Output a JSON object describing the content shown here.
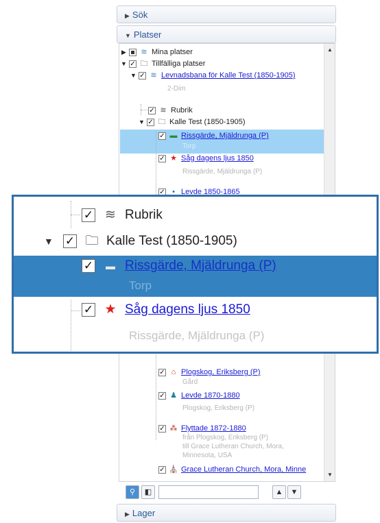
{
  "panel": {
    "sok_header": "Sök",
    "platser_header": "Platser",
    "lager_header": "Lager"
  },
  "tree": {
    "mina_platser": "Mina platser",
    "tillfalliga_platser": "Tillfälliga platser",
    "levnadsbana": "Levnadsbana för Kalle Test (1850-1905)",
    "dim": "2-Dim",
    "rubrik": "Rubrik",
    "kalle_test": "Kalle Test (1850-1905)",
    "rissgarde": "Rissgärde, Mjäldrunga (P)",
    "rissgarde_sub": "Torp",
    "sag_dagens": "Såg dagens ljus 1850",
    "sag_dagens_sub": "Rissgärde, Mjäldrunga (P)",
    "levde_1850": "Levde 1850-1865",
    "plogskog": "Plogskog, Eriksberg (P)",
    "plogskog_sub": "Gård",
    "levde_1870": "Levde 1870-1880",
    "levde_1870_sub": "Plogskog, Eriksberg (P)",
    "flyttade": "Flyttade 1872-1880",
    "flyttade_sub1": "från Plogskog, Eriksberg (P)",
    "flyttade_sub2": "till Grace Lutheran Church, Mora,",
    "flyttade_sub3": "Minnesota, USA",
    "grace": "Grace Lutheran Church, Mora, Minne"
  },
  "zoom": {
    "rubrik": "Rubrik",
    "kalle_test": "Kalle Test (1850-1905)",
    "rissgarde": "Rissgärde, Mjäldrunga (P)",
    "rissgarde_sub": "Torp",
    "sag_dagens": "Såg dagens ljus 1850",
    "sag_dagens_sub": "Rissgärde, Mjäldrunga (P)"
  },
  "colors": {
    "highlight_light": "#9fd3f5",
    "highlight_dark": "#3582c0",
    "link": "#1a1ad6",
    "star": "#e0201c",
    "callout_border": "#2f6faa"
  }
}
